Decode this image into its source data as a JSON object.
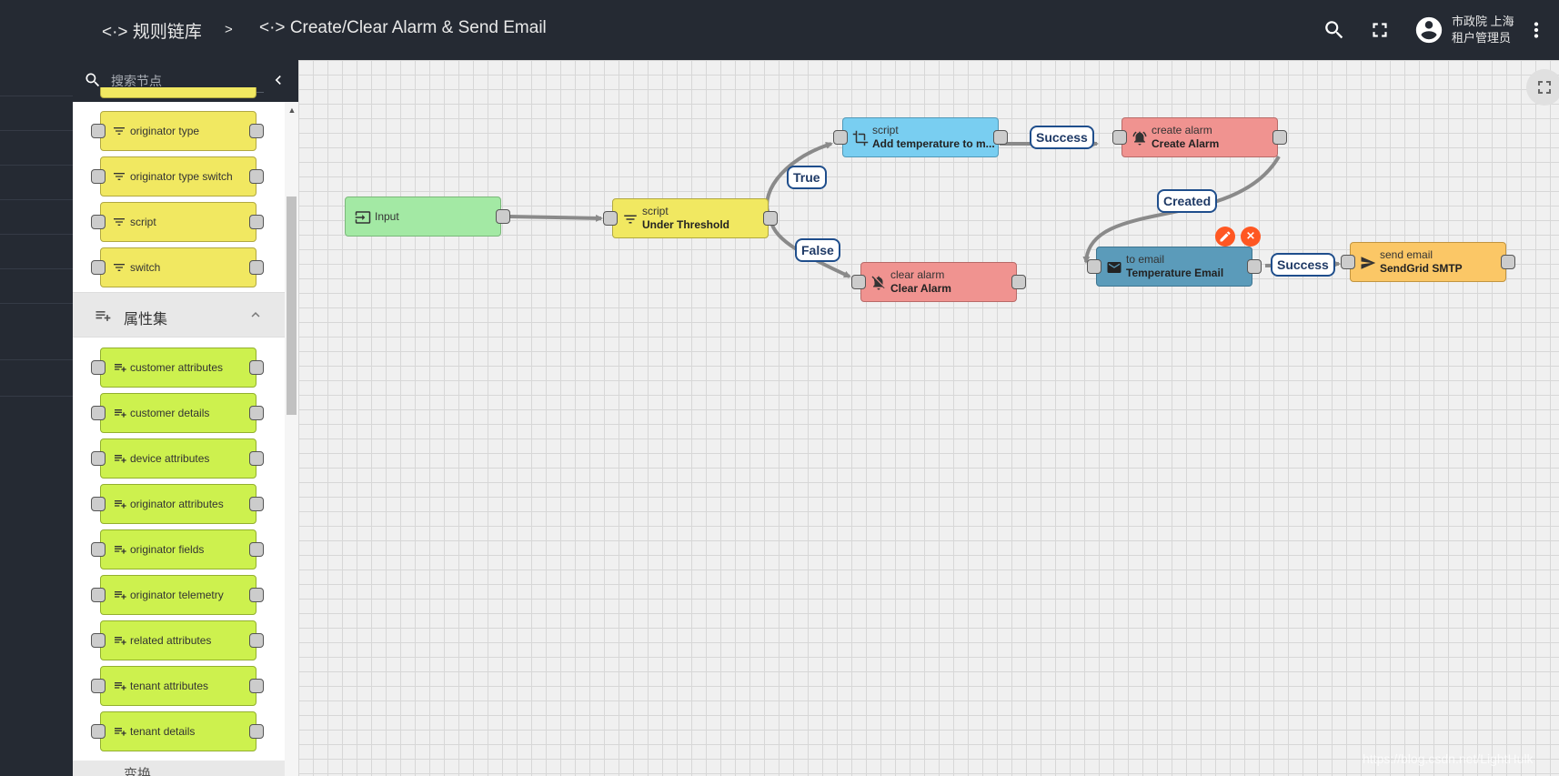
{
  "header": {
    "breadcrumb_root_icon": "<·>",
    "breadcrumb_root": "规则链库",
    "separator": ">",
    "breadcrumb_current_icon": "<·>",
    "breadcrumb_current": "Create/Clear Alarm & Send Email",
    "user_name": "市政院 上海",
    "user_role": "租户管理员",
    "icons": [
      "search-icon",
      "fullscreen-icon",
      "account-icon",
      "more-vert-icon"
    ]
  },
  "sidebar": {
    "search_placeholder": "搜索节点",
    "filter_nodes": [
      {
        "label": "originator type"
      },
      {
        "label": "originator type switch"
      },
      {
        "label": "script"
      },
      {
        "label": "switch"
      }
    ],
    "enrichment_section": {
      "title": "属性集",
      "nodes": [
        {
          "label": "customer attributes"
        },
        {
          "label": "customer details"
        },
        {
          "label": "device attributes"
        },
        {
          "label": "originator attributes"
        },
        {
          "label": "originator fields"
        },
        {
          "label": "originator telemetry"
        },
        {
          "label": "related attributes"
        },
        {
          "label": "tenant attributes"
        },
        {
          "label": "tenant details"
        }
      ]
    },
    "next_section_title": "变换"
  },
  "canvas": {
    "nodes": {
      "input": {
        "label": "Input",
        "color": "#a3e9a4"
      },
      "threshold": {
        "type": "script",
        "name": "Under Threshold",
        "color": "#f1e861"
      },
      "transform": {
        "type": "script",
        "name": "Add temperature to m...",
        "color": "#79cef1"
      },
      "create_alarm": {
        "type": "create alarm",
        "name": "Create Alarm",
        "color": "#f09390"
      },
      "clear_alarm": {
        "type": "clear alarm",
        "name": "Clear Alarm",
        "color": "#f09390"
      },
      "to_email": {
        "type": "to email",
        "name": "Temperature Email",
        "color": "#5b9bba"
      },
      "send_email": {
        "type": "send email",
        "name": "SendGrid SMTP",
        "color": "#fbc766"
      }
    },
    "links": {
      "true": "True",
      "false": "False",
      "success1": "Success",
      "created": "Created",
      "success2": "Success"
    }
  },
  "watermark": "https://blog.csdn.net/LightHulk"
}
